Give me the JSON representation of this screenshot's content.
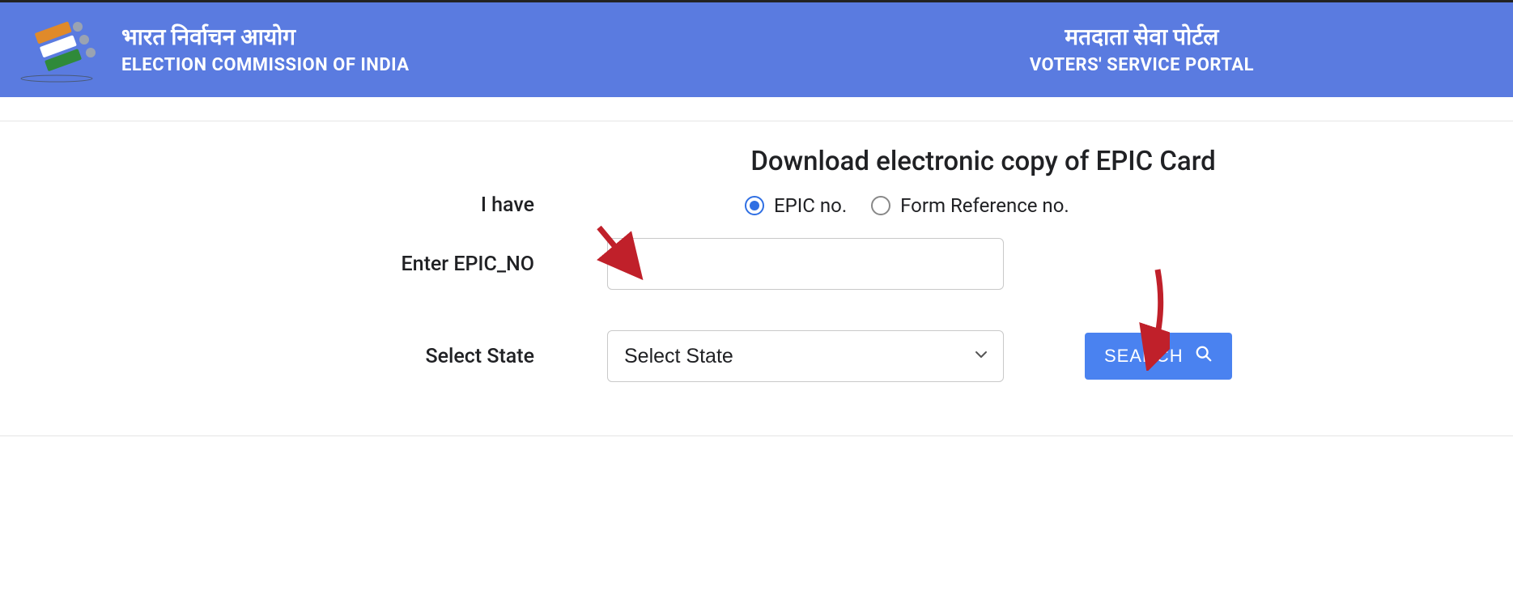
{
  "header": {
    "org_hi": "भारत निर्वाचन आयोग",
    "org_en": "ELECTION COMMISSION OF INDIA",
    "portal_hi": "मतदाता सेवा पोर्टल",
    "portal_en": "VOTERS' SERVICE PORTAL"
  },
  "main": {
    "title": "Download electronic copy of EPIC Card",
    "row1": {
      "label": "I have",
      "option1": "EPIC no.",
      "option2": "Form Reference no."
    },
    "row2": {
      "label": "Enter EPIC_NO",
      "value": ""
    },
    "row3": {
      "label": "Select State",
      "selected": "Select State"
    },
    "search_btn": "SEARCH"
  }
}
